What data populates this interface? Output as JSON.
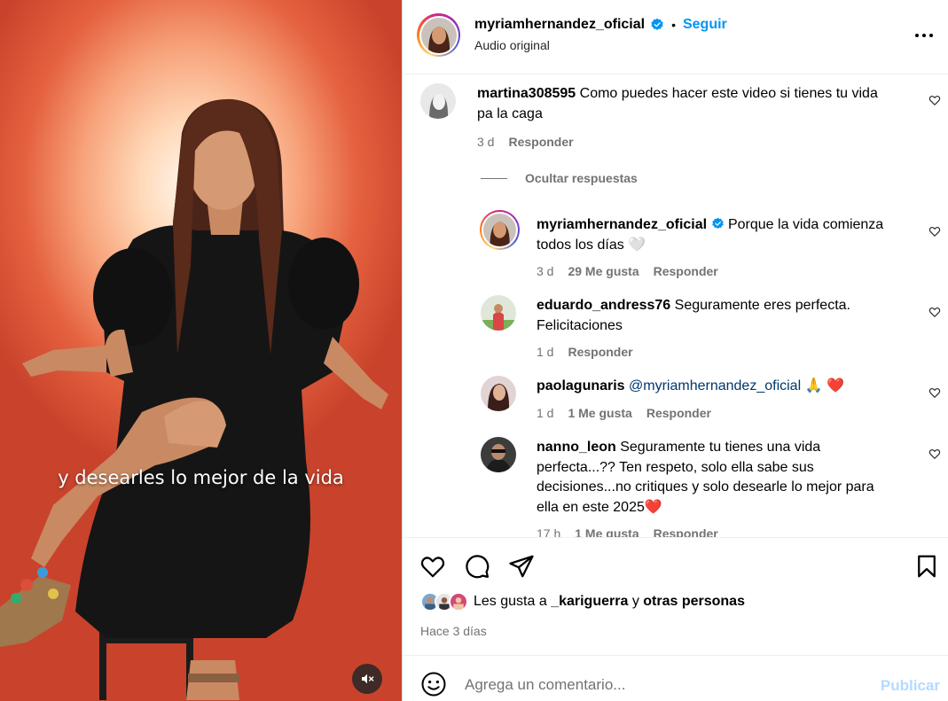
{
  "media": {
    "caption": "y desearles lo mejor de la vida"
  },
  "header": {
    "username": "myriamhernandez_oficial",
    "separator": "•",
    "follow_label": "Seguir",
    "audio_label": "Audio original"
  },
  "comments": [
    {
      "username": "martina308595",
      "text": "Como puedes hacer este video si tienes tu vida",
      "text2": "pa la caga",
      "time": "3 d",
      "reply": "Responder"
    },
    {
      "username": "myriamhernandez_oficial",
      "text": "Porque la vida comienza",
      "text2": "todos los días",
      "emoji": "🤍",
      "time": "3 d",
      "likes": "29 Me gusta",
      "reply": "Responder"
    },
    {
      "username": "eduardo_andress76",
      "text": "Seguramente eres perfecta.",
      "text2": "Felicitaciones",
      "time": "1 d",
      "reply": "Responder"
    },
    {
      "username": "paolagunaris",
      "mention": "@myriamhernandez_oficial",
      "emoji": "🙏 ❤️",
      "time": "1 d",
      "likes": "1 Me gusta",
      "reply": "Responder"
    },
    {
      "username": "nanno_leon",
      "text": "Seguramente tu tienes una vida",
      "text2": "perfecta...?? Ten respeto, solo ella sabe sus",
      "text3": "decisiones...no critiques y solo desearle lo mejor para",
      "text4": "ella en este 2025",
      "emoji": "❤️",
      "time": "17 h",
      "likes": "1 Me gusta",
      "reply": "Responder"
    }
  ],
  "hide_replies_label": "Ocultar respuestas",
  "likes": {
    "prefix": "Les gusta a",
    "user": "_kariguerra",
    "joiner": "y",
    "others": "otras personas"
  },
  "posted_ago": "Hace 3 días",
  "composer": {
    "placeholder": "Agrega un comentario...",
    "publish_label": "Publicar"
  },
  "colors": {
    "link_blue": "#0095f6",
    "muted_gray": "#737373",
    "publish_disabled": "#b3dbff",
    "heart_red": "#e0245e"
  }
}
